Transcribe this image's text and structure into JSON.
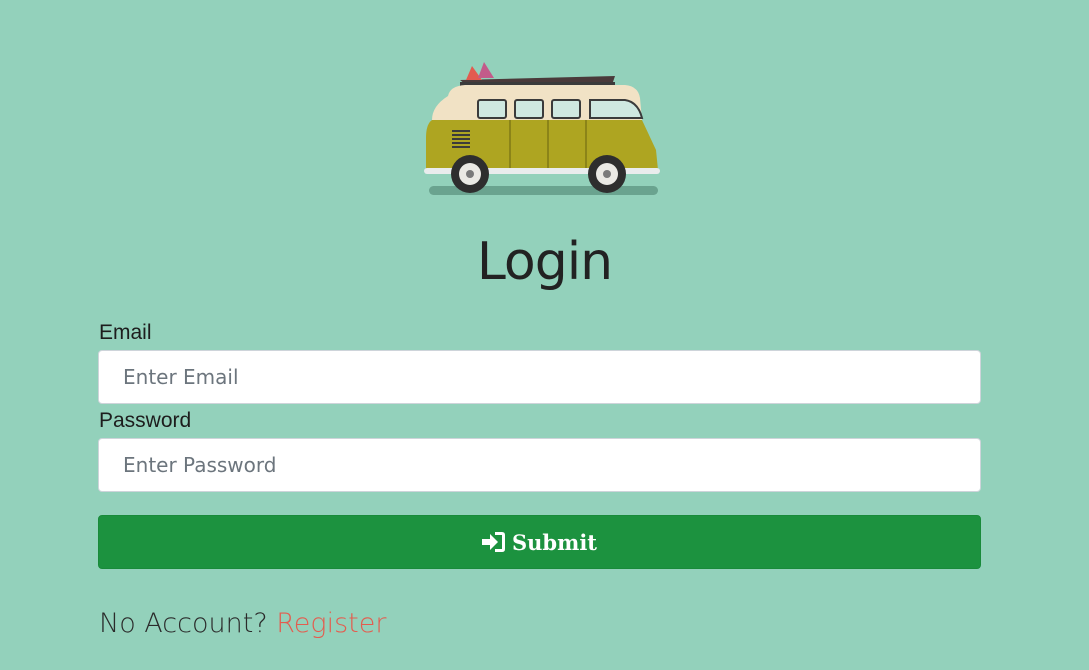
{
  "page": {
    "title": "Login"
  },
  "form": {
    "email_label": "Email",
    "email_placeholder": "Enter Email",
    "email_value": "",
    "password_label": "Password",
    "password_placeholder": "Enter Password",
    "password_value": "",
    "submit_label": "Submit"
  },
  "footer": {
    "prompt": "No Account?",
    "link_label": "Register"
  },
  "icons": {
    "logo": "camper-van-icon",
    "submit": "sign-in-icon"
  },
  "colors": {
    "background": "#93d1bb",
    "submit": "#1c923f",
    "link": "#e35d4f"
  }
}
